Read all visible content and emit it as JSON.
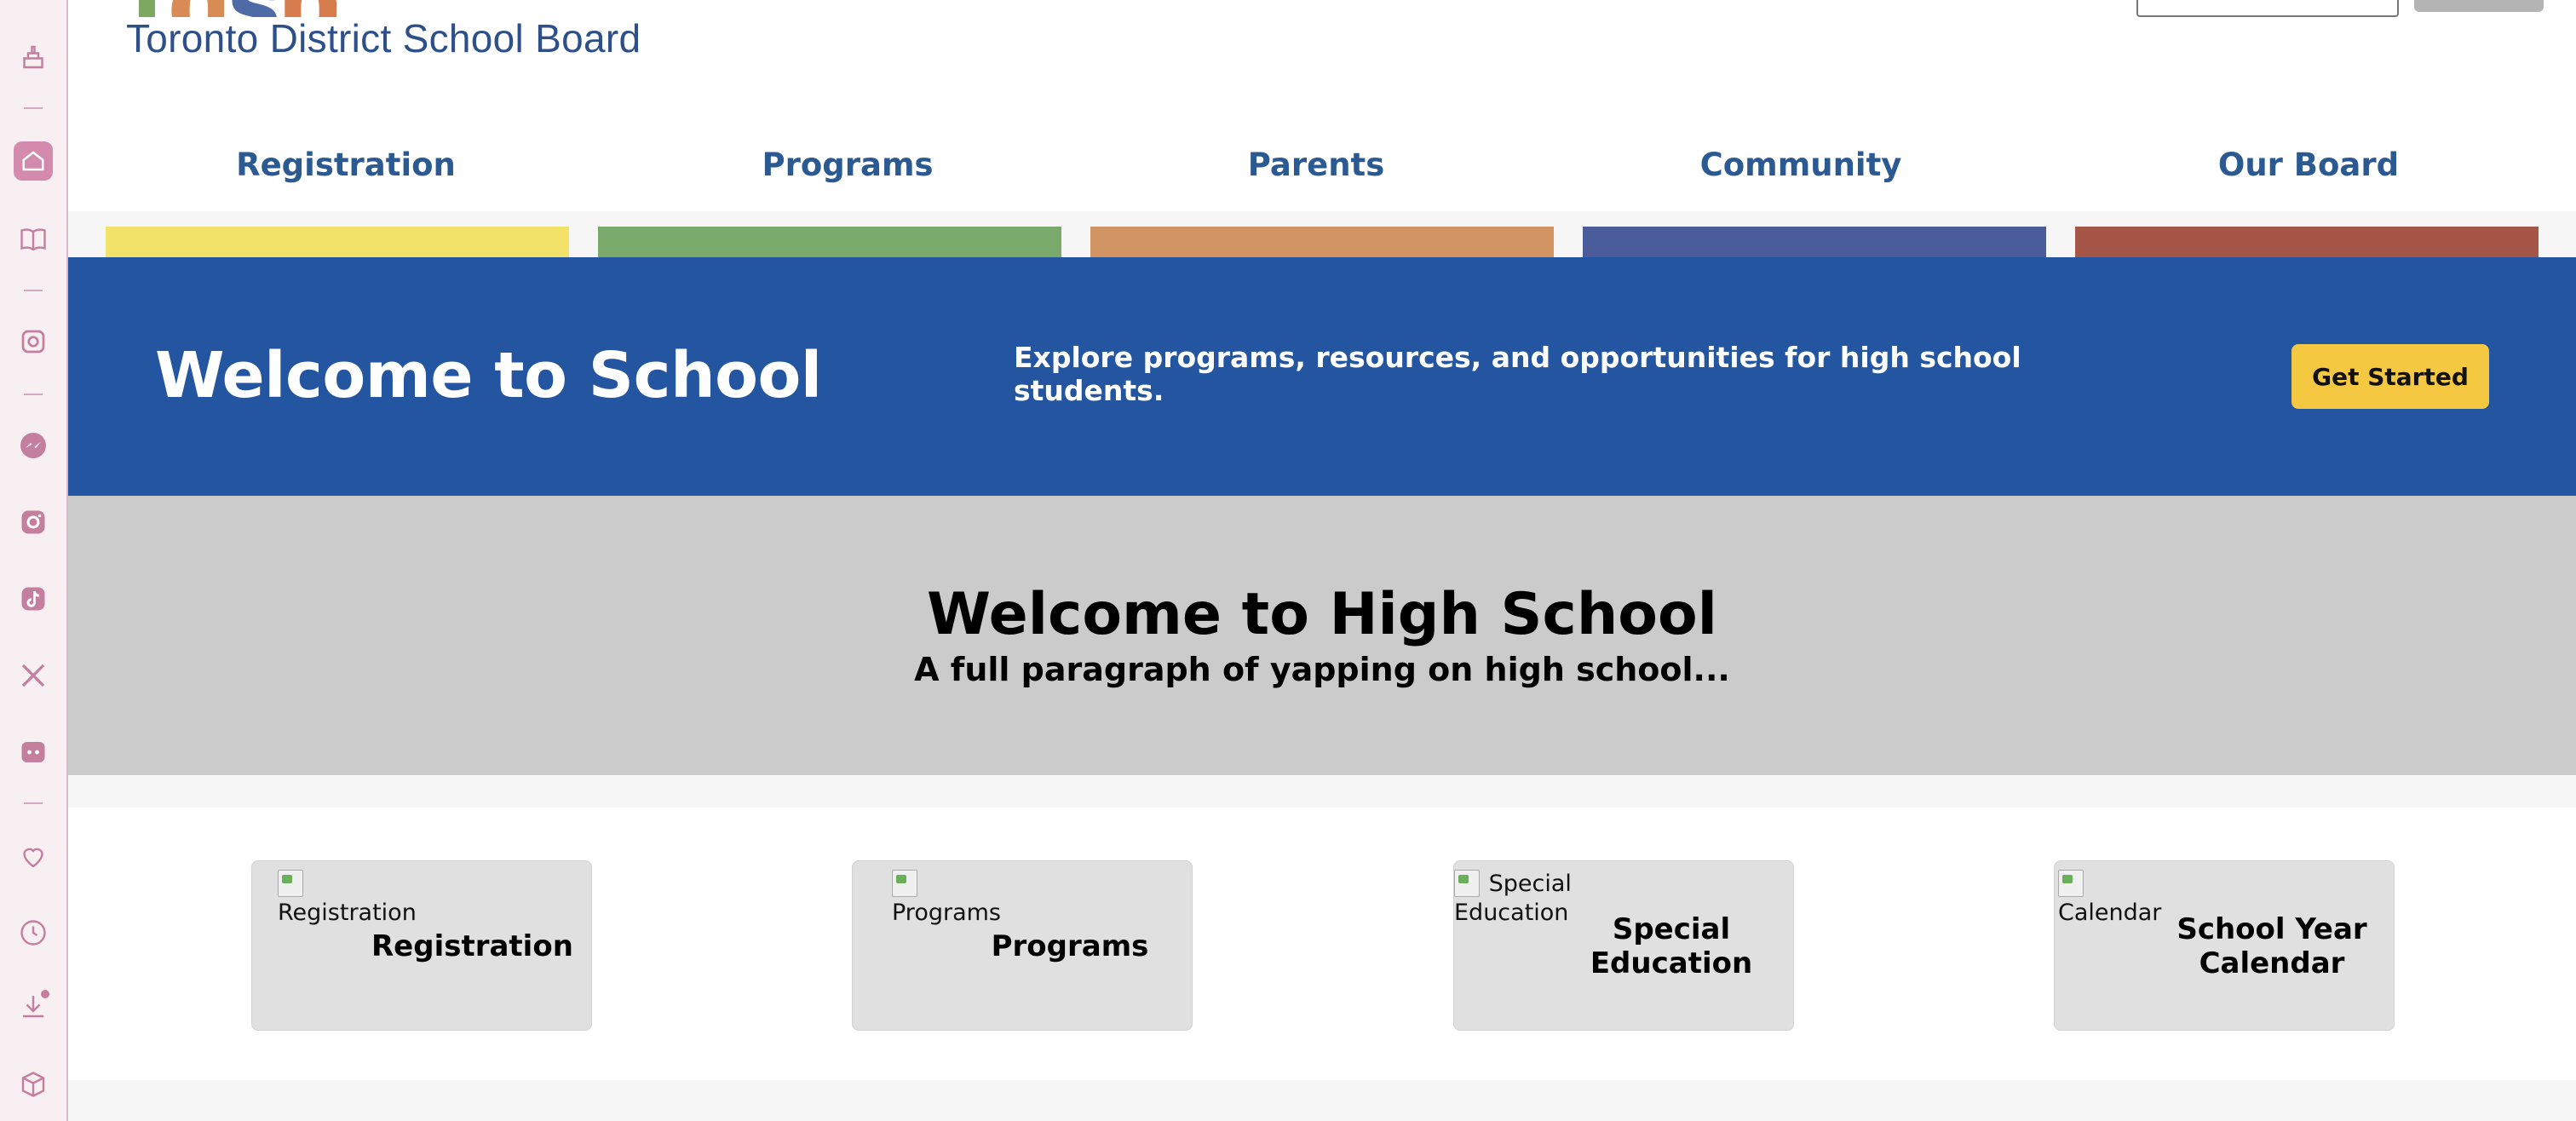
{
  "brand": {
    "name": "Toronto District School Board",
    "logo_letters": [
      "t",
      "d",
      "s",
      "b"
    ],
    "logo_colors": [
      "#7aa95f",
      "#d98b55",
      "#4e6aa7",
      "#d77c4d"
    ]
  },
  "nav": {
    "items": [
      {
        "label": "Registration",
        "color": "#f2e26a"
      },
      {
        "label": "Programs",
        "color": "#7aa96c"
      },
      {
        "label": "Parents",
        "color": "#d19462"
      },
      {
        "label": "Community",
        "color": "#4a5c99"
      },
      {
        "label": "Our Board",
        "color": "#a65646"
      }
    ]
  },
  "hero": {
    "title": "Welcome to School",
    "tagline": "Explore programs, resources, and opportunities for high school students.",
    "cta_label": "Get Started"
  },
  "intro": {
    "heading": "Welcome to High School",
    "body": "A full paragraph of yapping on high school..."
  },
  "cards": [
    {
      "alt": "Registration",
      "title": "Registration"
    },
    {
      "alt": "Programs",
      "title": "Programs"
    },
    {
      "alt": "Special Education",
      "title": "Special Education"
    },
    {
      "alt": "Calendar",
      "title": "School Year Calendar"
    }
  ],
  "sidebar": {
    "icons": [
      "brush-icon",
      "home-icon",
      "book-icon",
      "ai-icon",
      "messenger-icon",
      "instagram-icon",
      "tiktok-icon",
      "x-icon",
      "discord-icon",
      "heart-icon",
      "clock-icon",
      "download-icon",
      "box-icon"
    ]
  },
  "colors": {
    "primary_blue": "#2455a1",
    "cta_yellow": "#f5c842",
    "sidebar_accent": "#c47e9e"
  }
}
